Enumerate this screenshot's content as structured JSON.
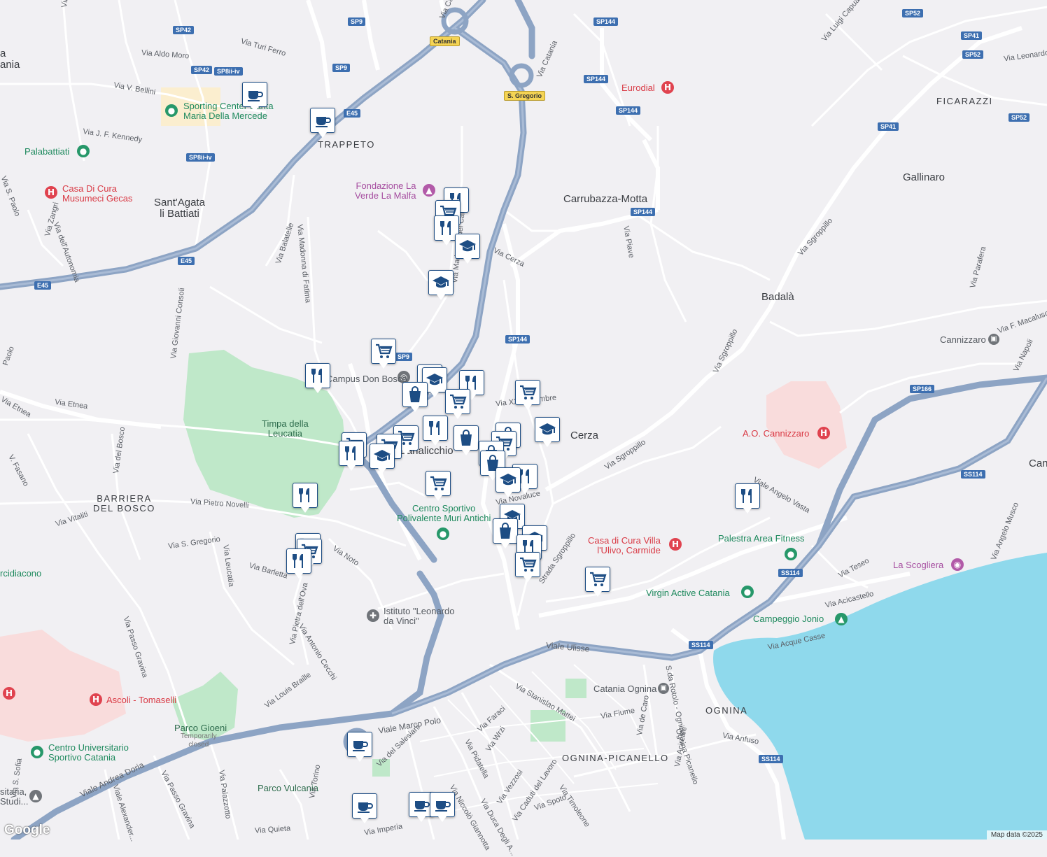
{
  "map": {
    "attribution": "Map data ©2025",
    "logo": "Google",
    "colors": {
      "land": "#f1f0f3",
      "water": "#8fd9ec",
      "park": "#bfe8c9",
      "hospital_area": "#f9dcdc",
      "highway": "#8da4c4",
      "road": "#ffffff"
    }
  },
  "places": {
    "trappeto": "TRAPPETO",
    "santagata": "Sant'Agata\nli Battiati",
    "carrubazza": "Carrubazza-Motta",
    "gallinaro": "Gallinaro",
    "badala": "Badalà",
    "ficarazzi": "FICARAZZI",
    "cerza": "Cerza",
    "canalicchio": "Canalicchio",
    "barriera": "BARRIERA\nDEL BOSCO",
    "ognina": "OGNINA",
    "ognina_picanello": "OGNINA-PICANELLO",
    "timpa": "Timpa della\nLeucatia",
    "parco_gioeni": "Parco Gioeni",
    "parco_gioeni_note": "Temporarily\nclosed",
    "parco_vulcania": "Parco Vulcania",
    "canni": "Cann",
    "catania_label": "Catania",
    "s_gregorio_label": "S. Gregorio",
    "partial_left": "ania",
    "partial_left2": "a"
  },
  "pois": {
    "eurodial": "Eurodial",
    "sporting": "Sporting Center Santa\nMaria Della Mercede",
    "palabattiati": "Palabattiati",
    "casa_musumeci": "Casa Di Cura\nMusumeci Gecas",
    "fondazione": "Fondazione La\nVerde La Malfa",
    "don_bosco": "Campus Don Bosco",
    "centro_sportivo": "Centro Sportivo\nPolivalente Muri Antichi",
    "istituto": "Istituto \"Leonardo\nda Vinci\"",
    "ao_cannizzaro": "A.O. Cannizzaro",
    "casa_ulivo": "Casa di Cura Villa\nl'Ulivo, Carmide",
    "palestra": "Palestra Area Fitness",
    "virgin": "Virgin Active Catania",
    "campeggio": "Campeggio Jonio",
    "scogliera": "La Scogliera",
    "cannizzaro_station": "Cannizzaro",
    "catania_ognina_station": "Catania Ognina",
    "ascoli": "Ascoli - Tomaselli",
    "centro_universitario": "Centro Universitario\nSportivo Catania",
    "arcidiacono": "rcidiacono",
    "universitaria": "sitaria,\nStudi..."
  },
  "streets": {
    "s1": "Via L. Da Vinci",
    "s2": "Via Aldo Moro",
    "s3": "Via Turi Ferro",
    "s4": "Via V. Bellini",
    "s5": "Via J. F. Kennedy",
    "s6": "Via S. Paolo",
    "s7": "Via Zangri",
    "s8": "Via dell'Autonomia",
    "s9": "Via Giovanni Consoli",
    "s10": "Via Balatelle",
    "s11": "Via Madonna di Fatima",
    "s12": "Via Catania",
    "s13": "Via Cerza",
    "s14": "Via Piave",
    "s15": "Via Sgroppillo",
    "s16": "Via Sgroppillo",
    "s17": "Via Sgroppillo",
    "s18": "Via Parafera",
    "s19": "Via F. Macaluso",
    "s20": "Via Napoli",
    "s21": "Via Etnea",
    "s22": "Via Etnea",
    "s23": "V. Fasano",
    "s24": "Via del Bosco",
    "s25": "Via Vitaliti",
    "s26": "Via Pietro Novelli",
    "s27": "Via S. Gregorio",
    "s28": "Via Leucatia",
    "s29": "Via Barletta",
    "s30": "Via Noto",
    "s31": "Via Pietra dell'Ova",
    "s32": "Via Antonio Cecchi",
    "s33": "Via Passo Gravina",
    "s34": "Via Louis Braille",
    "s35": "Viale Marco Polo",
    "s36": "Viale Ulisse",
    "s37": "Viale Andrea Doria",
    "s38": "Via XX Settembre",
    "s39": "Via Novaluce",
    "s40": "Strada Sgroppillo",
    "s41": "Viale Angelo Vasta",
    "s42": "Via Teseo",
    "s43": "Via Acicastello",
    "s44": "Via Acque Casse",
    "s45": "Via Angelo Musco",
    "s46": "Via Stanislao Mattei",
    "s47": "Via Fiume",
    "s48": "Via de Caro",
    "s49": "S.da Rotolo - Ognina",
    "s50": "Via Acireale",
    "s51": "Via Anfuso",
    "s52": "Via Faraci",
    "s53": "Via Pidatella",
    "s54": "Via Wrzi",
    "s55": "Via Vezzosi",
    "s56": "Via Caduti del Lavoro",
    "s57": "Via Timoleone",
    "s58": "Via Spoto",
    "s59": "Via del Salesiani",
    "s60": "Via Passo Gravina",
    "s61": "Via Palazzotto",
    "s62": "Via Torino",
    "s63": "Via Quieta",
    "s64": "Via Imperia",
    "s65": "Via Niccolò Giannotta",
    "s66": "Via Duca Degli A...",
    "s67": "Viale Alexander...",
    "s68": "Via S. Sofia",
    "s69": "Via Leonardo",
    "s70": "Via Luigi Capuana",
    "s71": "Paolo",
    "s72": "Via Catania",
    "s73": "Via Madonna del Carmine",
    "s74": "Ognina Picanello"
  },
  "shields": {
    "sp42": "SP42",
    "sp9": "SP9",
    "sp9b": "SP9",
    "sp9c": "SP9",
    "sp144a": "SP144",
    "sp144b": "SP144",
    "sp144c": "SP144",
    "sp144d": "SP144",
    "sp144e": "SP144",
    "sp8a": "SP8ii-iv",
    "sp8b": "SP8ii-iv",
    "sp42b": "SP42",
    "e45a": "E45",
    "e45b": "E45",
    "e45c": "E45",
    "sp52a": "SP52",
    "sp52b": "SP52",
    "sp52c": "SP52",
    "sp41a": "SP41",
    "sp41b": "SP41",
    "sp166": "SP166",
    "ss114a": "SS114",
    "ss114b": "SS114",
    "ss114c": "SS114",
    "ss114d": "SS114"
  },
  "markers": {
    "types": [
      "cafe-icon",
      "restaurant-icon",
      "grocery-icon",
      "school-icon",
      "shopping-icon"
    ]
  }
}
